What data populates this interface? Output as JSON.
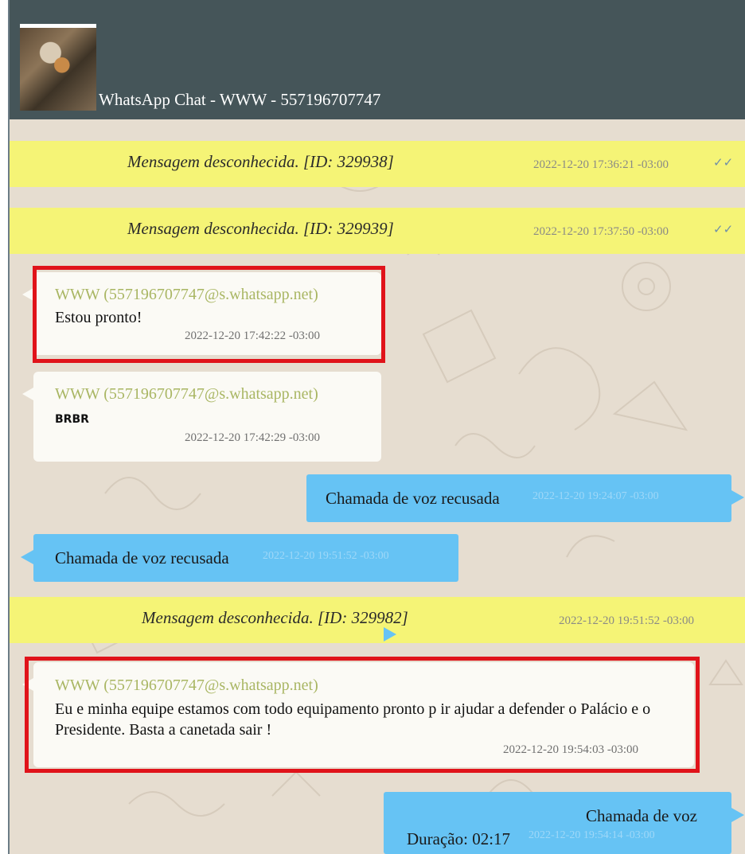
{
  "header": {
    "title": "WhatsApp Chat - WWW - 557196707747"
  },
  "messages": [
    {
      "type": "system",
      "text": "Mensagem desconhecida. [ID: 329938]",
      "time": "2022-12-20 17:36:21 -03:00",
      "ticks": "✓✓"
    },
    {
      "type": "system",
      "text": "Mensagem desconhecida. [ID: 329939]",
      "time": "2022-12-20 17:37:50 -03:00",
      "ticks": "✓✓"
    },
    {
      "type": "incoming",
      "sender": "WWW (557196707747@s.whatsapp.net)",
      "text": "Estou pronto!",
      "time": "2022-12-20 17:42:22 -03:00",
      "highlighted": true
    },
    {
      "type": "incoming",
      "sender": "WWW (557196707747@s.whatsapp.net)",
      "text": "BRBR",
      "time": "2022-12-20 17:42:29 -03:00",
      "highlighted": false
    },
    {
      "type": "call-outgoing",
      "text": "Chamada de voz recusada",
      "time": "2022-12-20 19:24:07 -03:00"
    },
    {
      "type": "call-incoming",
      "text": "Chamada de voz recusada",
      "time": "2022-12-20 19:51:52 -03:00"
    },
    {
      "type": "system",
      "text": "Mensagem desconhecida. [ID: 329982]",
      "time": "2022-12-20 19:51:52 -03:00"
    },
    {
      "type": "incoming",
      "sender": "WWW (557196707747@s.whatsapp.net)",
      "text": "Eu e minha equipe estamos com todo equipamento pronto p ir ajudar a defender o Palácio e o Presidente. Basta a canetada sair !",
      "time": "2022-12-20 19:54:03 -03:00",
      "highlighted": true
    },
    {
      "type": "call-outgoing",
      "text": "Chamada de voz",
      "duration": "Duração: 02:17",
      "time": "2022-12-20 19:54:14 -03:00"
    }
  ],
  "colors": {
    "header": "#455559",
    "system_bg": "#f5f476",
    "incoming_bg": "#fbfaf5",
    "call_bg": "#66c3f4",
    "sender": "#a9b663",
    "highlight": "#e0131a"
  }
}
